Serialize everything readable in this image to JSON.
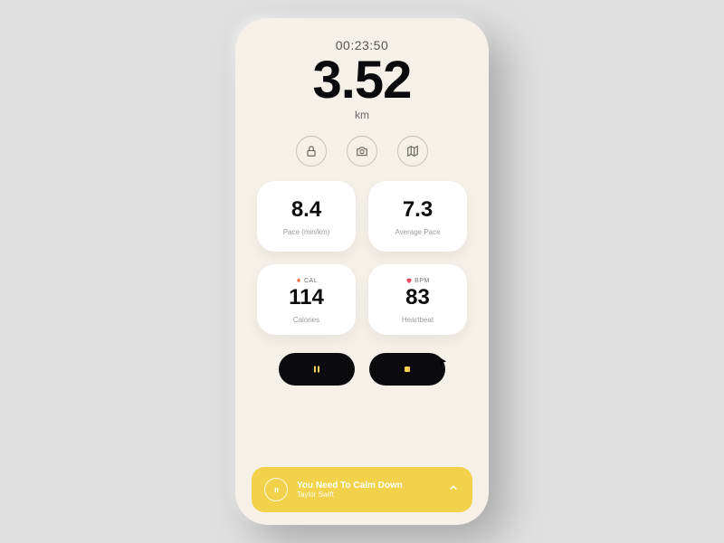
{
  "timer": "00:23:50",
  "distance": {
    "value": "3.52",
    "unit": "km"
  },
  "actions": {
    "lock": "lock-icon",
    "camera": "camera-icon",
    "map": "map-icon"
  },
  "stats": {
    "pace": {
      "value": "8.4",
      "label": "Pace (min/km)"
    },
    "avg_pace": {
      "value": "7.3",
      "label": "Average Pace"
    },
    "calories": {
      "badge": "CAL",
      "value": "114",
      "label": "Calories"
    },
    "heart": {
      "badge": "BPM",
      "value": "83",
      "label": "Heartbeat"
    }
  },
  "controls": {
    "pause": "pause",
    "stop": "stop"
  },
  "music": {
    "title": "You Need To Calm Down",
    "artist": "Taylor Swift"
  },
  "colors": {
    "accent": "#f3d24b",
    "dark": "#0b0b0d"
  }
}
